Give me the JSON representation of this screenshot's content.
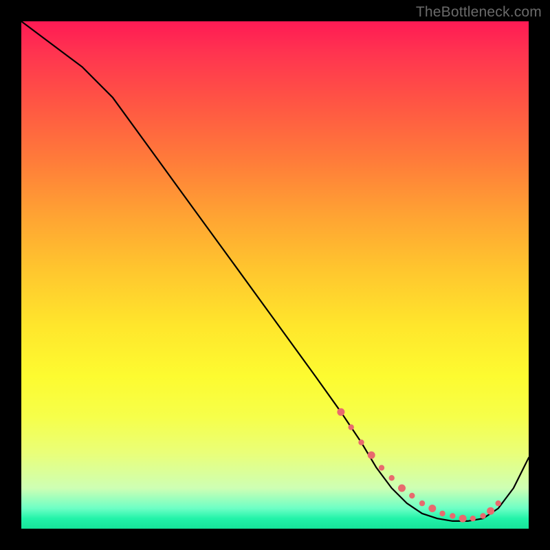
{
  "watermark": {
    "text": "TheBottleneck.com"
  },
  "chart_data": {
    "type": "line",
    "title": "",
    "xlabel": "",
    "ylabel": "",
    "xlim": [
      0,
      100
    ],
    "ylim": [
      0,
      100
    ],
    "grid": false,
    "legend": false,
    "background": "rainbow-gradient (red top → green bottom)",
    "series": [
      {
        "name": "bottleneck-curve",
        "x": [
          0,
          4,
          8,
          12,
          18,
          26,
          34,
          42,
          50,
          58,
          63,
          67,
          70,
          73,
          76,
          79,
          82,
          85,
          88,
          91,
          94,
          97,
          100
        ],
        "y": [
          100,
          97,
          94,
          91,
          85,
          74,
          63,
          52,
          41,
          30,
          23,
          17,
          12,
          8,
          5,
          3,
          2,
          1.5,
          1.5,
          2,
          4,
          8,
          14
        ]
      }
    ],
    "markers": {
      "name": "trough-dots",
      "x": [
        63,
        65,
        67,
        69,
        71,
        73,
        75,
        77,
        79,
        81,
        83,
        85,
        87,
        89,
        91,
        92.5,
        94
      ],
      "y": [
        23,
        20,
        17,
        14.5,
        12,
        10,
        8,
        6.5,
        5,
        4,
        3,
        2.5,
        2,
        2,
        2.5,
        3.5,
        5
      ]
    }
  }
}
